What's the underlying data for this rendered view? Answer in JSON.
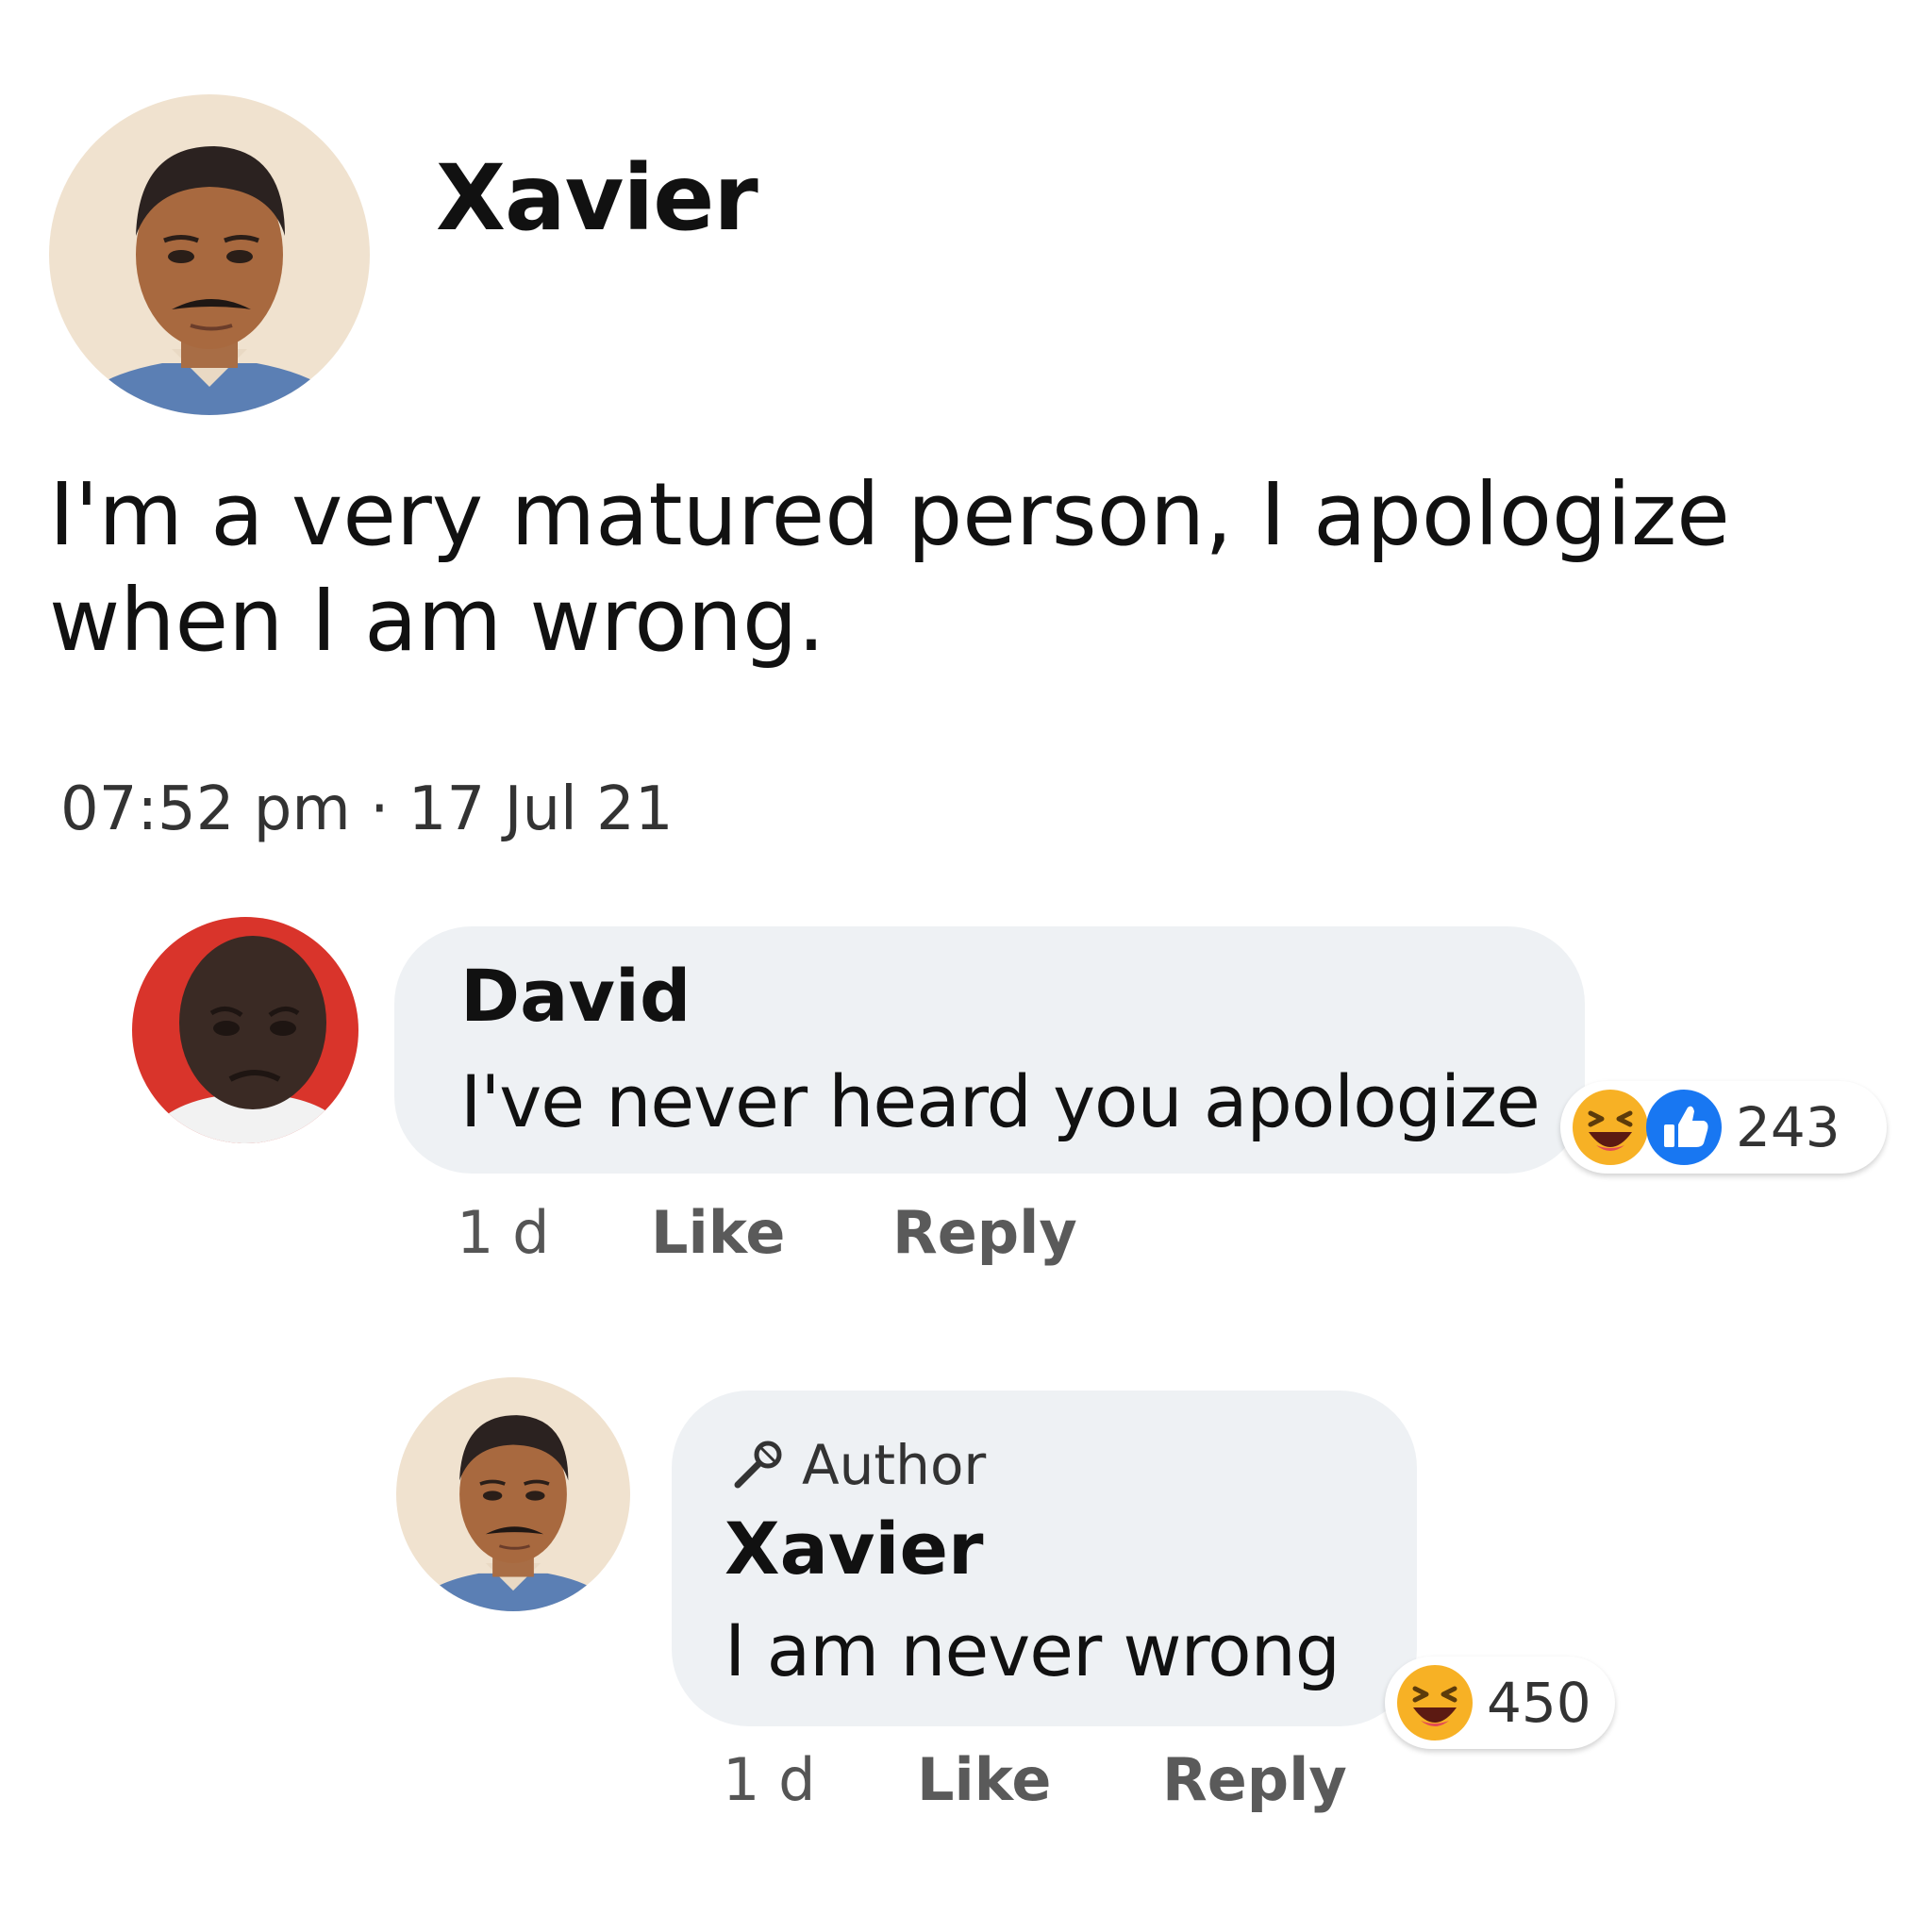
{
  "post": {
    "author": "Xavier",
    "text": "I'm a very matured person, I apologize when I am wrong.",
    "timestamp": "07:52 pm · 17 Jul 21"
  },
  "comments": [
    {
      "name": "David",
      "text": "I've never heard you apologize",
      "age": "1 d",
      "like_label": "Like",
      "reply_label": "Reply",
      "reactions": [
        "haha",
        "like"
      ],
      "reaction_count": "243"
    },
    {
      "badge": "Author",
      "name": "Xavier",
      "text": "I am never wrong",
      "age": "1 d",
      "like_label": "Like",
      "reply_label": "Reply",
      "reactions": [
        "haha"
      ],
      "reaction_count": "450"
    }
  ],
  "colors": {
    "bubble": "#eef1f4",
    "like_blue": "#1877f2",
    "haha_yellow": "#f7b125",
    "avatar_red_bg": "#d9342b"
  }
}
